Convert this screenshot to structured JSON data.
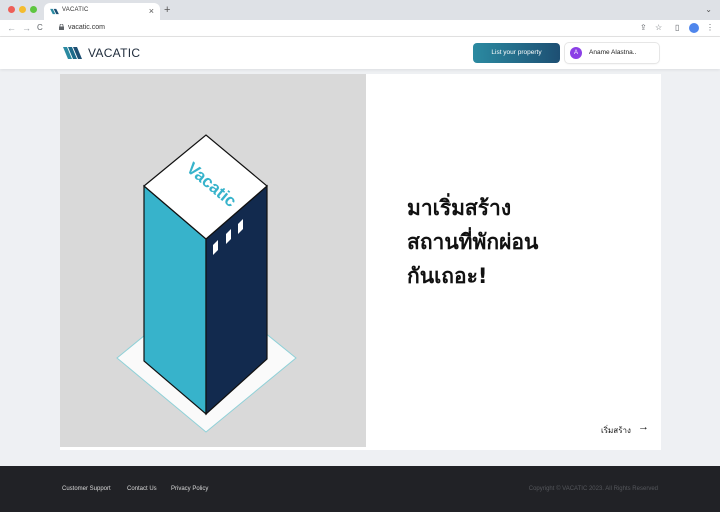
{
  "browser": {
    "tab_title": "VACATIC",
    "tab_close": "×",
    "new_tab": "+",
    "url": "vacatic.com",
    "nav_back": "←",
    "nav_forward": "→",
    "nav_reload": "C",
    "share_icon": "⇪",
    "star_icon": "☆",
    "sidebar_icon": "▯",
    "menu_icon": "⋮",
    "chevron": "⌄"
  },
  "header": {
    "logo_text": "VACATIC",
    "list_property_label": "List your property",
    "user_initial": "A",
    "user_name": "Aname Alastna..",
    "brand_color": "#1d4f73",
    "accent_color": "#2b8aa1"
  },
  "hero": {
    "building_label": "Vacatic",
    "headline": [
      "มาเริ่มสร้าง",
      "สถานที่พักผ่อน",
      "กันเถอะ!"
    ],
    "cta_label": "เริ่มสร้าง",
    "cta_arrow": "→"
  },
  "footer": {
    "links": [
      "Customer Support",
      "Contact Us",
      "Privacy Policy"
    ],
    "copyright": "Copyright © VACATIC 2023. All Rights Reserved"
  }
}
